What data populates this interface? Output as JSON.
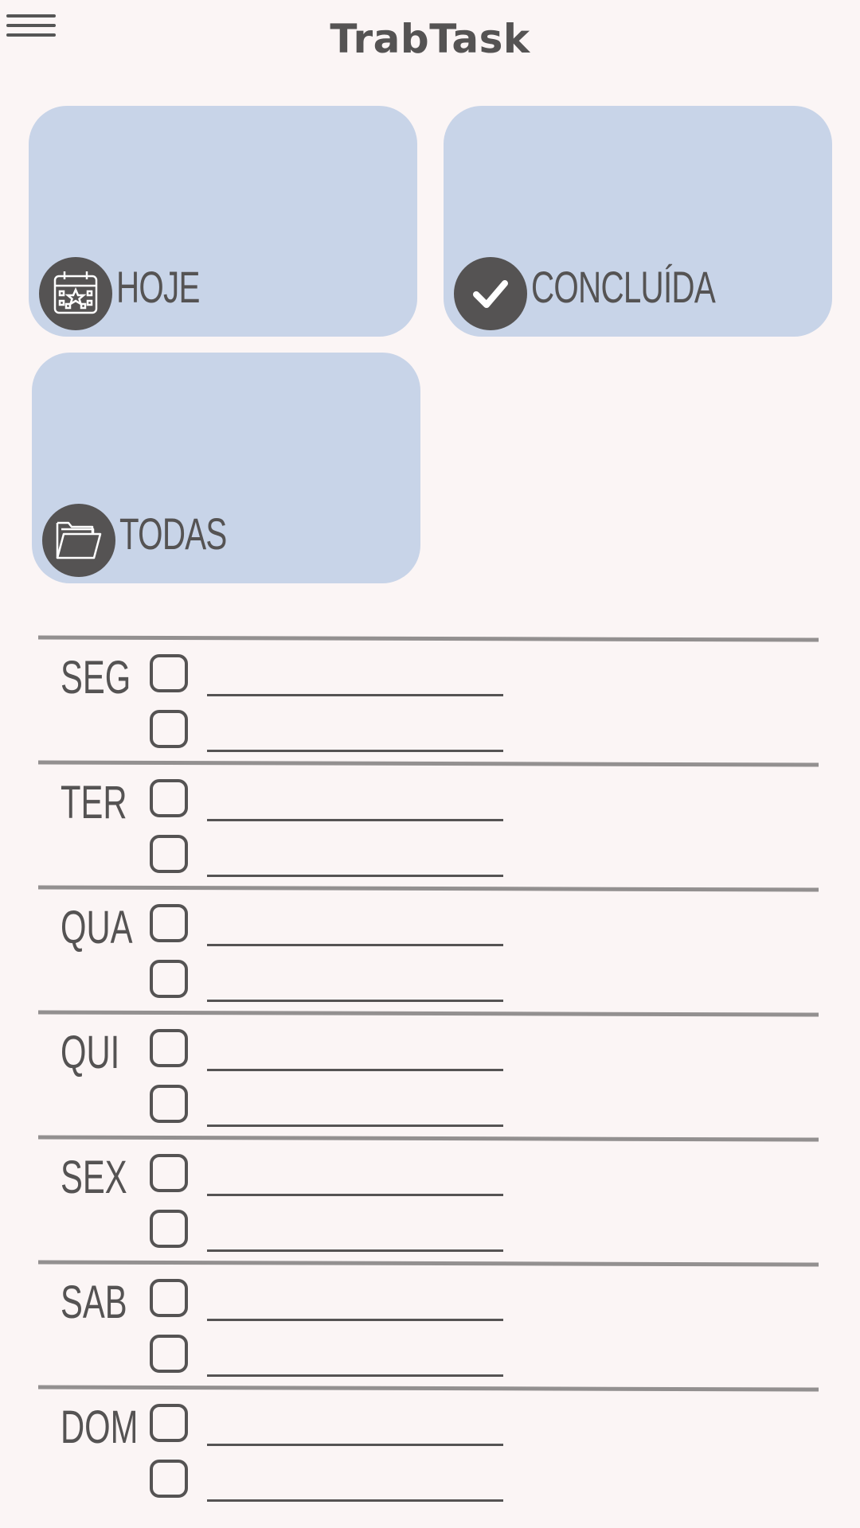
{
  "header": {
    "title": "TrabTask",
    "menu_icon": "hamburger-menu-icon"
  },
  "cards": [
    {
      "id": "hoje",
      "label": "HOJE",
      "icon": "calendar-icon"
    },
    {
      "id": "concluida",
      "label": "CONCLUÍDA",
      "icon": "checkmark-icon"
    },
    {
      "id": "todas",
      "label": "TODAS",
      "icon": "folder-icon"
    }
  ],
  "week": {
    "days": [
      {
        "label": "SEG",
        "tasks": [
          {
            "checked": false,
            "text": ""
          },
          {
            "checked": false,
            "text": ""
          }
        ]
      },
      {
        "label": "TER",
        "tasks": [
          {
            "checked": false,
            "text": ""
          },
          {
            "checked": false,
            "text": ""
          }
        ]
      },
      {
        "label": "QUA",
        "tasks": [
          {
            "checked": false,
            "text": ""
          },
          {
            "checked": false,
            "text": ""
          }
        ]
      },
      {
        "label": "QUI",
        "tasks": [
          {
            "checked": false,
            "text": ""
          },
          {
            "checked": false,
            "text": ""
          }
        ]
      },
      {
        "label": "SEX",
        "tasks": [
          {
            "checked": false,
            "text": ""
          },
          {
            "checked": false,
            "text": ""
          }
        ]
      },
      {
        "label": "SAB",
        "tasks": [
          {
            "checked": false,
            "text": ""
          },
          {
            "checked": false,
            "text": ""
          }
        ]
      },
      {
        "label": "DOM",
        "tasks": [
          {
            "checked": false,
            "text": ""
          },
          {
            "checked": false,
            "text": ""
          }
        ]
      }
    ]
  },
  "colors": {
    "background": "#fbf5f5",
    "card": "#c8d4e8",
    "text": "#555353",
    "divider": "#939090"
  }
}
